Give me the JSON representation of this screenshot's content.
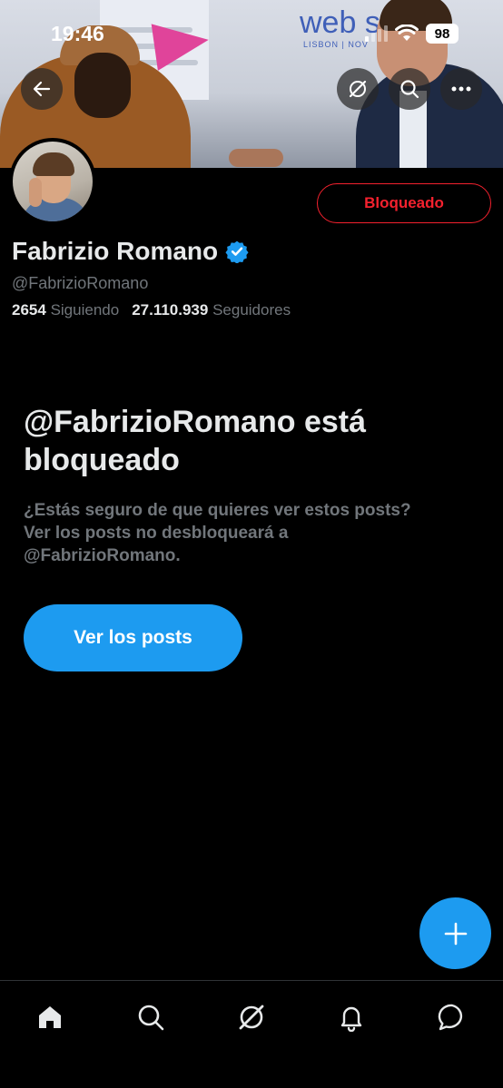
{
  "status_bar": {
    "time": "19:46",
    "battery": "98"
  },
  "banner": {
    "logo_text": "web su",
    "logo_sub": "LISBON | NOV"
  },
  "profile": {
    "name": "Fabrizio Romano",
    "handle": "@FabrizioRomano",
    "following_count": "2654",
    "following_label": "Siguiendo",
    "followers_count": "27.110.939",
    "followers_label": "Seguidores",
    "blocked_button_label": "Bloqueado",
    "verified_color": "#1d9bf0"
  },
  "blocked_notice": {
    "title": "@FabrizioRomano está bloqueado",
    "line1": "¿Estás seguro de que quieres ver estos posts?",
    "line2": "Ver los posts no desbloqueará a",
    "line3": "@FabrizioRomano.",
    "button_label": "Ver los posts"
  },
  "colors": {
    "accent": "#1d9bf0",
    "danger": "#f4212e",
    "muted": "#71767b",
    "text": "#e7e9ea"
  },
  "icons": {
    "top": [
      "back-arrow-icon",
      "grok-icon",
      "search-icon",
      "more-icon"
    ],
    "bottom_nav": [
      "home-icon",
      "search-icon",
      "grok-icon",
      "notifications-icon",
      "messages-icon"
    ],
    "fab": "plus-icon"
  }
}
